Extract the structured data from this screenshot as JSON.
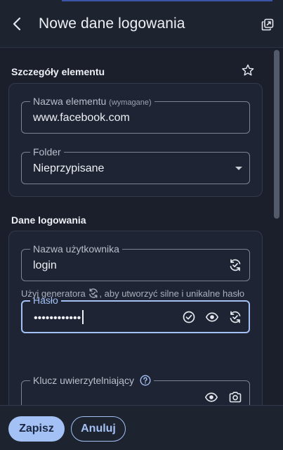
{
  "header": {
    "title": "Nowe dane logowania",
    "back_icon": "chevron-left-icon",
    "popout_icon": "popout-icon"
  },
  "item_details": {
    "section_title": "Szczegóły elementu",
    "favorite_icon": "star-outline-icon",
    "name_field": {
      "label": "Nazwa elementu",
      "label_suffix": "(wymagane)",
      "value": "www.facebook.com"
    },
    "folder_field": {
      "label": "Folder",
      "value": "Nieprzypisane"
    }
  },
  "login": {
    "section_title": "Dane logowania",
    "username_field": {
      "label": "Nazwa użytkownika",
      "value": "login"
    },
    "password_field": {
      "label": "Hasło",
      "value": "••••••••••••"
    },
    "hint_before": "Użyj generatora",
    "hint_after": ", aby utworzyć silne i unikalne hasło",
    "auth_key_field": {
      "label": "Klucz uwierzytelniający"
    }
  },
  "footer": {
    "save_label": "Zapisz",
    "cancel_label": "Anuluj"
  },
  "colors": {
    "accent": "#a3c1f5",
    "background": "#1a1f2b",
    "card": "#1e2433"
  }
}
